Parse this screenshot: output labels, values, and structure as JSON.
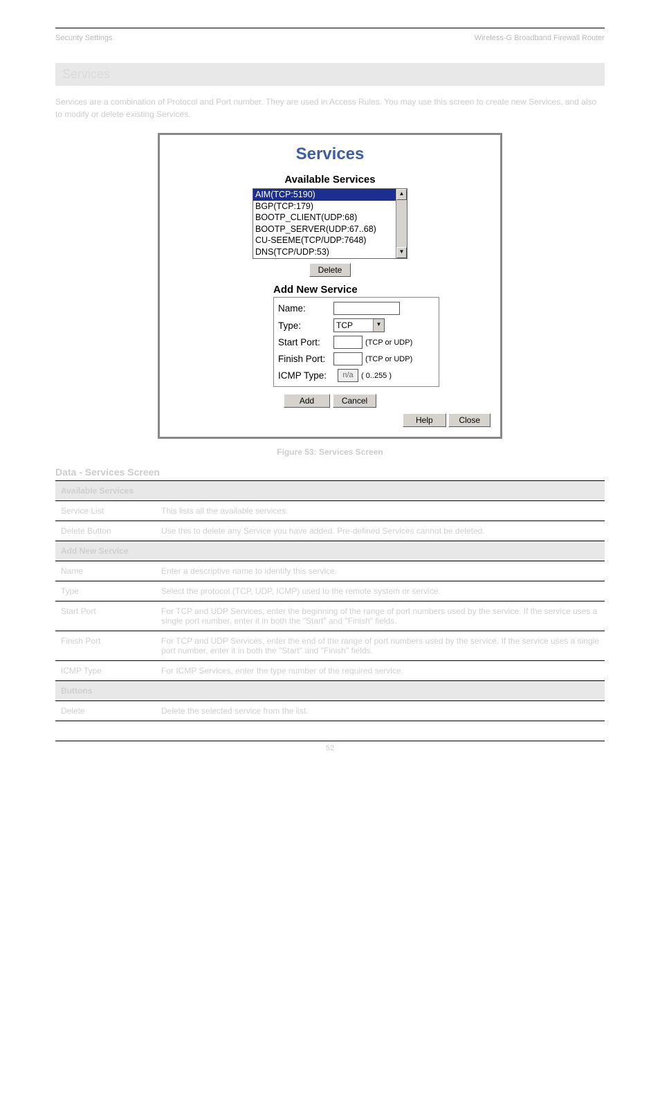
{
  "header": {
    "left": "Security Settings",
    "right": "Wireless-G Broadband Firewall Router"
  },
  "section_title": "Services",
  "intro": "Services are a combination of Protocol and Port number. They are used in Access Rules. You may use this screen to create new Services, and also to modify or delete existing Services.",
  "dialog": {
    "title": "Services",
    "available_label": "Available Services",
    "list": [
      {
        "label": "AIM(TCP:5190)",
        "selected": true
      },
      {
        "label": "BGP(TCP:179)",
        "selected": false
      },
      {
        "label": "BOOTP_CLIENT(UDP:68)",
        "selected": false
      },
      {
        "label": "BOOTP_SERVER(UDP:67..68)",
        "selected": false
      },
      {
        "label": "CU-SEEME(TCP/UDP:7648)",
        "selected": false
      },
      {
        "label": "DNS(TCP/UDP:53)",
        "selected": false
      }
    ],
    "delete_btn": "Delete",
    "add_title": "Add New Service",
    "form": {
      "name_label": "Name:",
      "type_label": "Type:",
      "type_value": "TCP",
      "start_label": "Start Port:",
      "start_hint": "(TCP or UDP)",
      "finish_label": "Finish Port:",
      "finish_hint": "(TCP or UDP)",
      "icmp_label": "ICMP Type:",
      "icmp_value": "n/a",
      "icmp_hint": "( 0..255 )"
    },
    "add_btn": "Add",
    "cancel_btn": "Cancel",
    "help_btn": "Help",
    "close_btn": "Close"
  },
  "figure_caption": "Figure 53: Services Screen",
  "data_heading": "Data - Services Screen",
  "table": {
    "sections": [
      {
        "title": "Available Services",
        "rows": [
          {
            "k": "Service List",
            "v": "This lists all the available services."
          },
          {
            "k": "Delete Button",
            "v": "Use this to delete any Service you have added. Pre-defined Services cannot be deleted."
          }
        ]
      },
      {
        "title": "Add New Service",
        "rows": [
          {
            "k": "Name",
            "v": "Enter a descriptive name to identify this service."
          },
          {
            "k": "Type",
            "v": "Select the protocol (TCP, UDP, ICMP) used to the remote system or service."
          },
          {
            "k": "Start Port",
            "v": "For TCP and UDP Services, enter the beginning of the range of port numbers used by the service. If the service uses a single port number, enter it in both the \"Start\" and \"Finish\" fields."
          },
          {
            "k": "Finish Port",
            "v": "For TCP and UDP Services, enter the end of the range of port numbers used by the service. If the service uses a single port number, enter it in both the \"Start\" and \"Finish\" fields."
          },
          {
            "k": "ICMP Type",
            "v": "For ICMP Services, enter the type number of the required service."
          }
        ]
      },
      {
        "title": "Buttons",
        "rows": [
          {
            "k": "Delete",
            "v": "Delete the selected service from the list."
          }
        ]
      }
    ]
  },
  "footer": "52"
}
